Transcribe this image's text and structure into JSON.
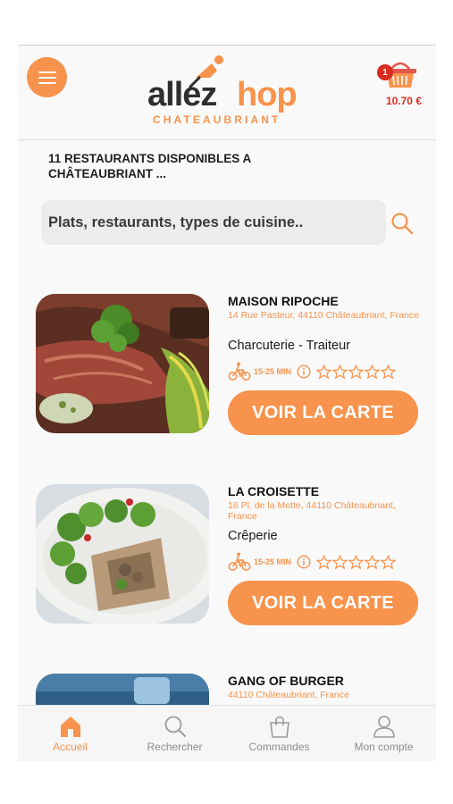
{
  "app": {
    "logo_word_1": "allez",
    "logo_word_2": "hop",
    "logo_sub": "CHATEAUBRIANT",
    "accent_color": "#f7934c"
  },
  "header": {
    "menu_icon": "hamburger-menu-icon",
    "cart": {
      "count": "1",
      "total": "10.70 €",
      "icon": "basket-icon"
    }
  },
  "listing": {
    "title": "11 RESTAURANTS DISPONIBLES A CHÂTEAUBRIANT ..."
  },
  "search": {
    "placeholder": "Plats, restaurants, types de cuisine..",
    "icon": "search-icon"
  },
  "restaurants": [
    {
      "name": "MAISON RIPOCHE",
      "address": "14 Rue Pasteur, 44110 Châteaubriant, France",
      "cuisine": "Charcuterie - Traiteur",
      "delivery_time": "15-25 MIN",
      "rating": 0,
      "cta": "VOIR LA CARTE"
    },
    {
      "name": "LA CROISETTE",
      "address": "16 Pl. de la Motte, 44110 Châteaubriant, France",
      "cuisine": "Crêperie",
      "delivery_time": "15-25 MIN",
      "rating": 0,
      "cta": "VOIR LA CARTE"
    },
    {
      "name": "GANG OF BURGER",
      "address": "44110 Châteaubriant, France",
      "cuisine": "",
      "delivery_time": "",
      "rating": 0,
      "cta": ""
    }
  ],
  "bottom_nav": [
    {
      "label": "Accueil",
      "icon": "home-icon",
      "active": true
    },
    {
      "label": "Rechercher",
      "icon": "search-icon",
      "active": false
    },
    {
      "label": "Commandes",
      "icon": "shopping-bag-icon",
      "active": false
    },
    {
      "label": "Mon compte",
      "icon": "user-icon",
      "active": false
    }
  ]
}
